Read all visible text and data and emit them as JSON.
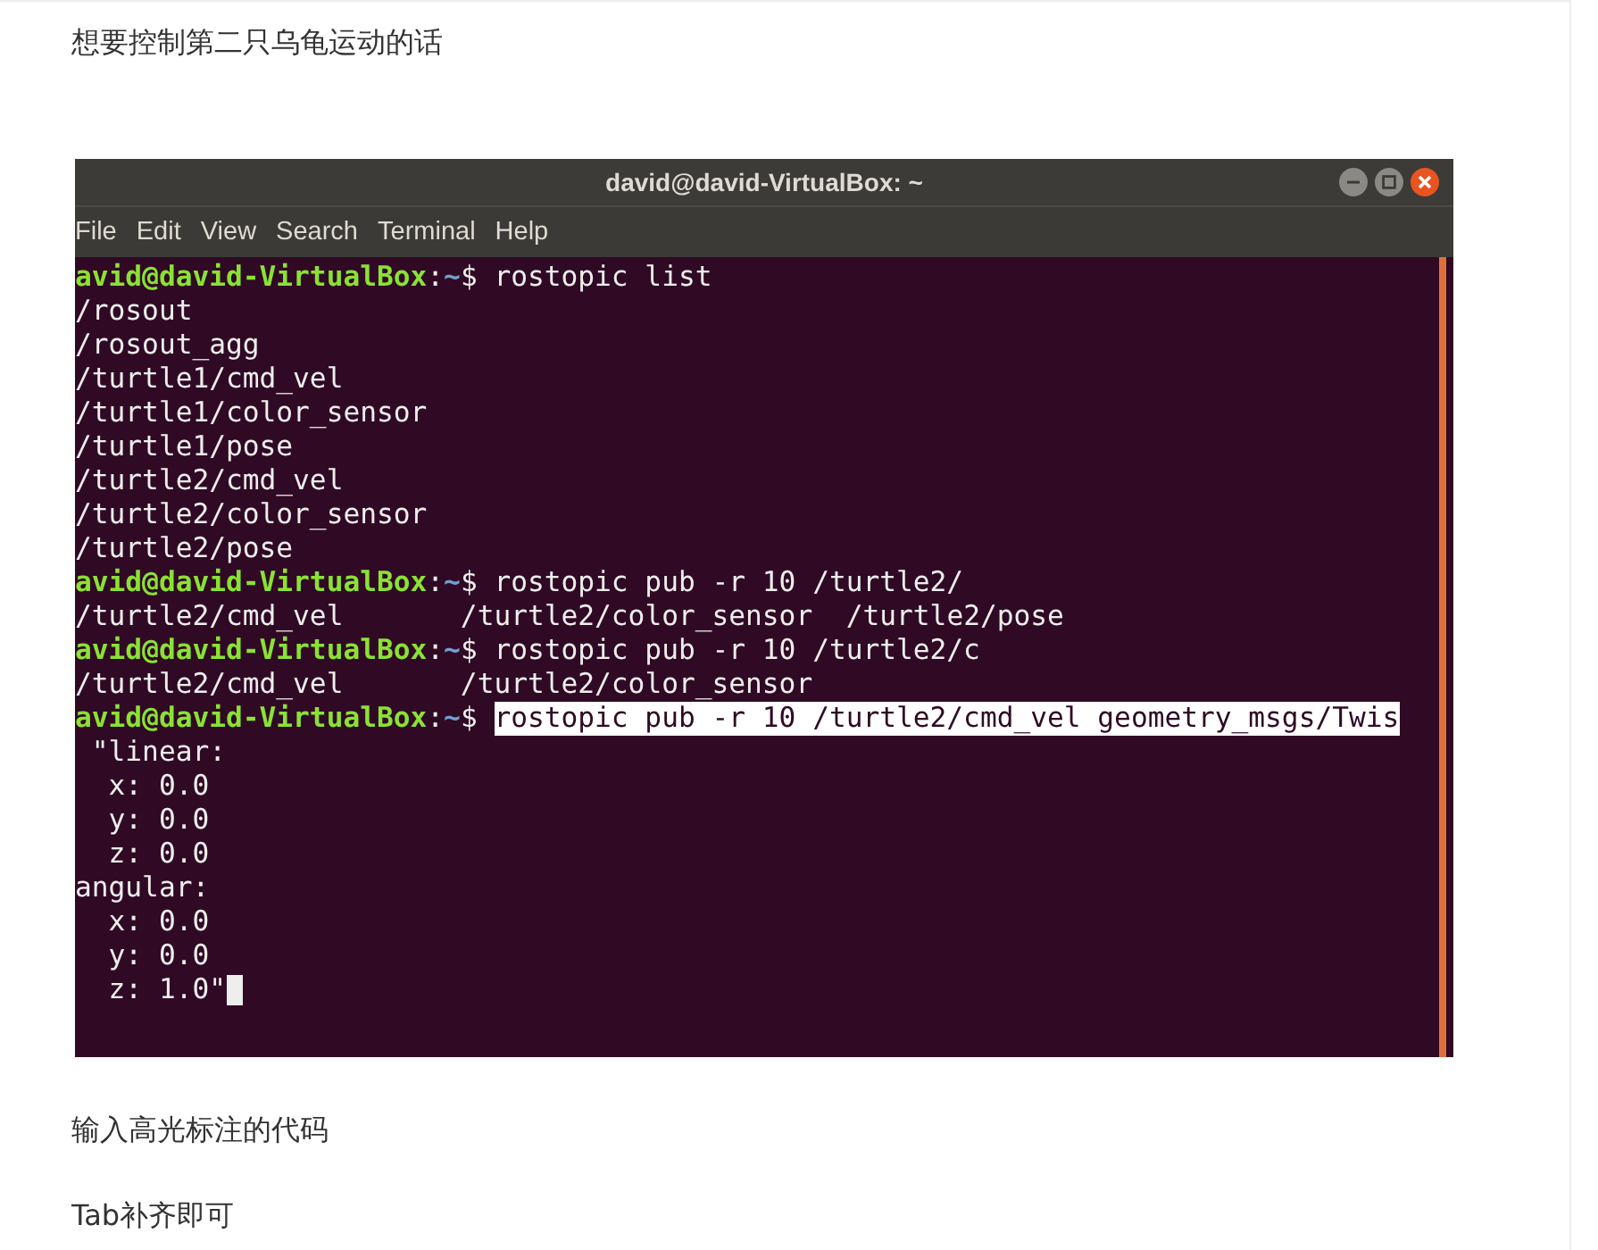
{
  "intro": "想要控制第二只乌龟运动的话",
  "terminal": {
    "title": "david@david-VirtualBox: ~",
    "menu": [
      "File",
      "Edit",
      "View",
      "Search",
      "Terminal",
      "Help"
    ],
    "lines": [
      {
        "kind": "prompt",
        "user": "avid@david-VirtualBox",
        "sep": ":",
        "path": "~",
        "sigil": "$",
        "command": "rostopic list",
        "highlighted": false
      },
      {
        "kind": "output",
        "text": "/rosout"
      },
      {
        "kind": "output",
        "text": "/rosout_agg"
      },
      {
        "kind": "output",
        "text": "/turtle1/cmd_vel"
      },
      {
        "kind": "output",
        "text": "/turtle1/color_sensor"
      },
      {
        "kind": "output",
        "text": "/turtle1/pose"
      },
      {
        "kind": "output",
        "text": "/turtle2/cmd_vel"
      },
      {
        "kind": "output",
        "text": "/turtle2/color_sensor"
      },
      {
        "kind": "output",
        "text": "/turtle2/pose"
      },
      {
        "kind": "prompt",
        "user": "avid@david-VirtualBox",
        "sep": ":",
        "path": "~",
        "sigil": "$",
        "command": "rostopic pub -r 10 /turtle2/",
        "highlighted": false
      },
      {
        "kind": "output",
        "text": "/turtle2/cmd_vel       /turtle2/color_sensor  /turtle2/pose"
      },
      {
        "kind": "prompt",
        "user": "avid@david-VirtualBox",
        "sep": ":",
        "path": "~",
        "sigil": "$",
        "command": "rostopic pub -r 10 /turtle2/c",
        "highlighted": false
      },
      {
        "kind": "output",
        "text": "/turtle2/cmd_vel       /turtle2/color_sensor"
      },
      {
        "kind": "prompt",
        "user": "avid@david-VirtualBox",
        "sep": ":",
        "path": "~",
        "sigil": "$",
        "command": "rostopic pub -r 10 /turtle2/cmd_vel geometry_msgs/Twis",
        "highlighted": true
      },
      {
        "kind": "output",
        "text": " \"linear:"
      },
      {
        "kind": "output",
        "text": "  x: 0.0"
      },
      {
        "kind": "output",
        "text": "  y: 0.0"
      },
      {
        "kind": "output",
        "text": "  z: 0.0"
      },
      {
        "kind": "output",
        "text": "angular:"
      },
      {
        "kind": "output",
        "text": "  x: 0.0"
      },
      {
        "kind": "output",
        "text": "  y: 0.0"
      },
      {
        "kind": "output",
        "text": "  z: 1.0\"",
        "cursor": true
      }
    ]
  },
  "paragraphs": [
    "输入高光标注的代码",
    "Tab补齐即可"
  ]
}
